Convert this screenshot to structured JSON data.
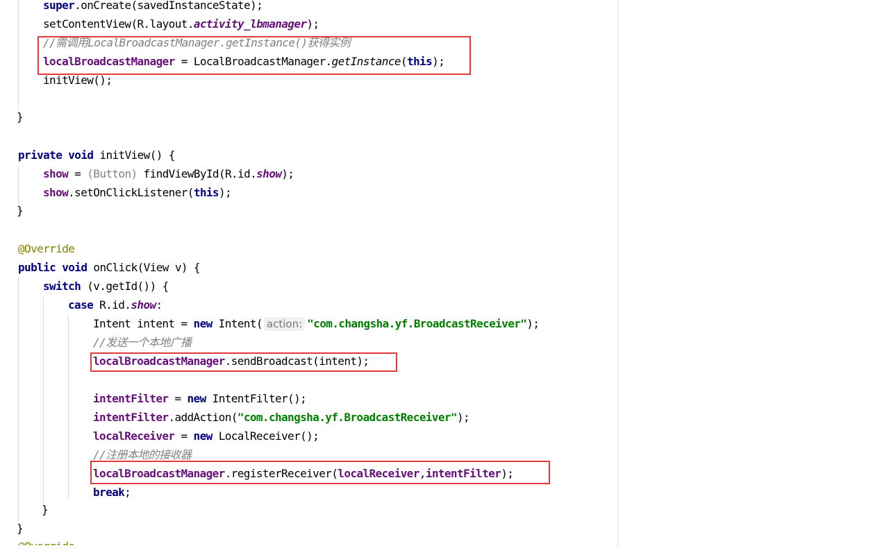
{
  "code": {
    "l1": {
      "t1": "super",
      "t2": ".onCreate(savedInstanceState);"
    },
    "l2": {
      "t1": "setContentView(R.layout.",
      "t2": "activity_lbmanager",
      "t3": ");"
    },
    "l3": {
      "c": "//需调用LocalBroadcastManager.getInstance()获得实例"
    },
    "l4": {
      "t1": "localBroadcastManager",
      "t2": " = LocalBroadcastManager.",
      "t3": "getInstance",
      "t4": "(",
      "t5": "this",
      "t6": ");"
    },
    "l5": {
      "t1": "initView();"
    },
    "l6": {
      "t1": "}"
    },
    "l7": {
      "t1": "private void",
      "t2": " initView() {"
    },
    "l8": {
      "t1": "show",
      "t2": " = ",
      "t3": "(Button)",
      "t4": " findViewById(R.id.",
      "t5": "show",
      "t6": ");"
    },
    "l9": {
      "t1": "show",
      "t2": ".setOnClickListener(",
      "t3": "this",
      "t4": ");"
    },
    "l10": {
      "t1": "}"
    },
    "l11": {
      "t1": "@Override"
    },
    "l12": {
      "t1": "public void",
      "t2": " onClick(View v) {"
    },
    "l13": {
      "t1": "switch",
      "t2": " (v.getId()) {"
    },
    "l14": {
      "t1": "case",
      "t2": " R.id.",
      "t3": "show",
      "t4": ":"
    },
    "l15": {
      "t1": "Intent intent = ",
      "t2": "new",
      "t3": " Intent(",
      "hint": "action:",
      "t4": "\"com.changsha.yf.BroadcastReceiver\"",
      "t5": ");"
    },
    "l16": {
      "c": "//发送一个本地广播"
    },
    "l17": {
      "t1": "localBroadcastManager",
      "t2": ".sendBroadcast(intent);"
    },
    "l18": {
      "t1": "intentFilter",
      "t2": " = ",
      "t3": "new",
      "t4": " IntentFilter();"
    },
    "l19": {
      "t1": "intentFilter",
      "t2": ".addAction(",
      "t3": "\"com.changsha.yf.BroadcastReceiver\"",
      "t4": ");"
    },
    "l20": {
      "t1": "localReceiver",
      "t2": " = ",
      "t3": "new",
      "t4": " LocalReceiver();"
    },
    "l21": {
      "c": "//注册本地的接收器"
    },
    "l22": {
      "t1": "localBroadcastManager",
      "t2": ".registerReceiver(",
      "t3": "localReceiver",
      "t4": ",",
      "t5": "intentFilter",
      "t6": ");"
    },
    "l23": {
      "t1": "break",
      "t2": ";"
    },
    "l24": {
      "t1": "}"
    },
    "l25": {
      "t1": "}"
    },
    "l26": {
      "t1": "@Override"
    }
  },
  "colors": {
    "keyword": "#000080",
    "field": "#660e7a",
    "string": "#008000",
    "comment": "#808080",
    "annotation": "#808000",
    "highlight_box": "#e03a3a"
  }
}
